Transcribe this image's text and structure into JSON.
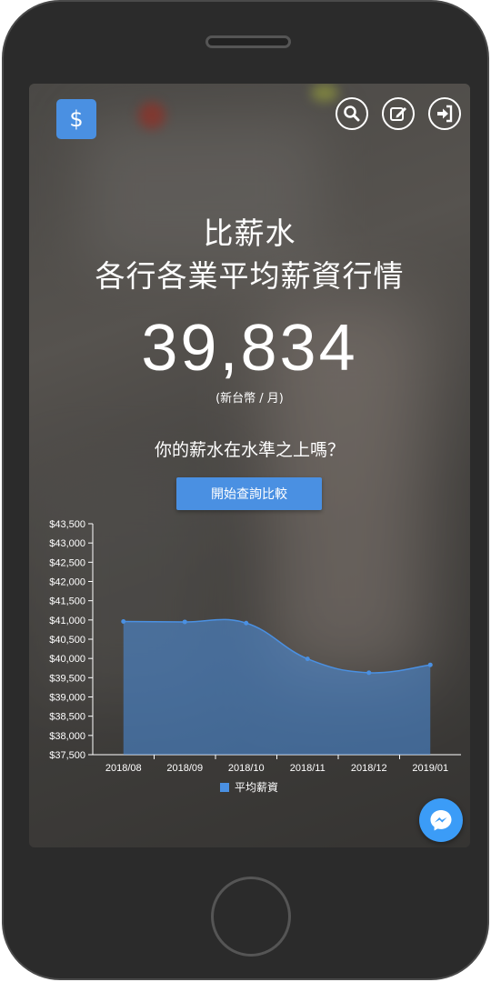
{
  "header": {
    "logo_symbol": "$",
    "icons": [
      "search-icon",
      "edit-icon",
      "sign-in-icon"
    ]
  },
  "hero": {
    "title_line1": "比薪水",
    "title_line2": "各行各業平均薪資行情",
    "average_salary": "39,834",
    "unit": "(新台幣 / 月)",
    "question": "你的薪水在水準之上嗎？",
    "cta_label": "開始查詢比較"
  },
  "colors": {
    "accent": "#4a90e2",
    "messenger": "#3b9cf7"
  },
  "chart_data": {
    "type": "area",
    "x": [
      "2018/08",
      "2018/09",
      "2018/10",
      "2018/11",
      "2018/12",
      "2019/01"
    ],
    "series": [
      {
        "name": "平均薪資",
        "values": [
          40960,
          40950,
          40920,
          39990,
          39630,
          39834
        ]
      }
    ],
    "ylim": [
      37500,
      43500
    ],
    "yticks": [
      "$43,500",
      "$43,000",
      "$42,500",
      "$42,000",
      "$41,500",
      "$41,000",
      "$40,500",
      "$40,000",
      "$39,500",
      "$39,000",
      "$38,500",
      "$38,000",
      "$37,500"
    ],
    "legend": "bottom",
    "grid": false
  }
}
